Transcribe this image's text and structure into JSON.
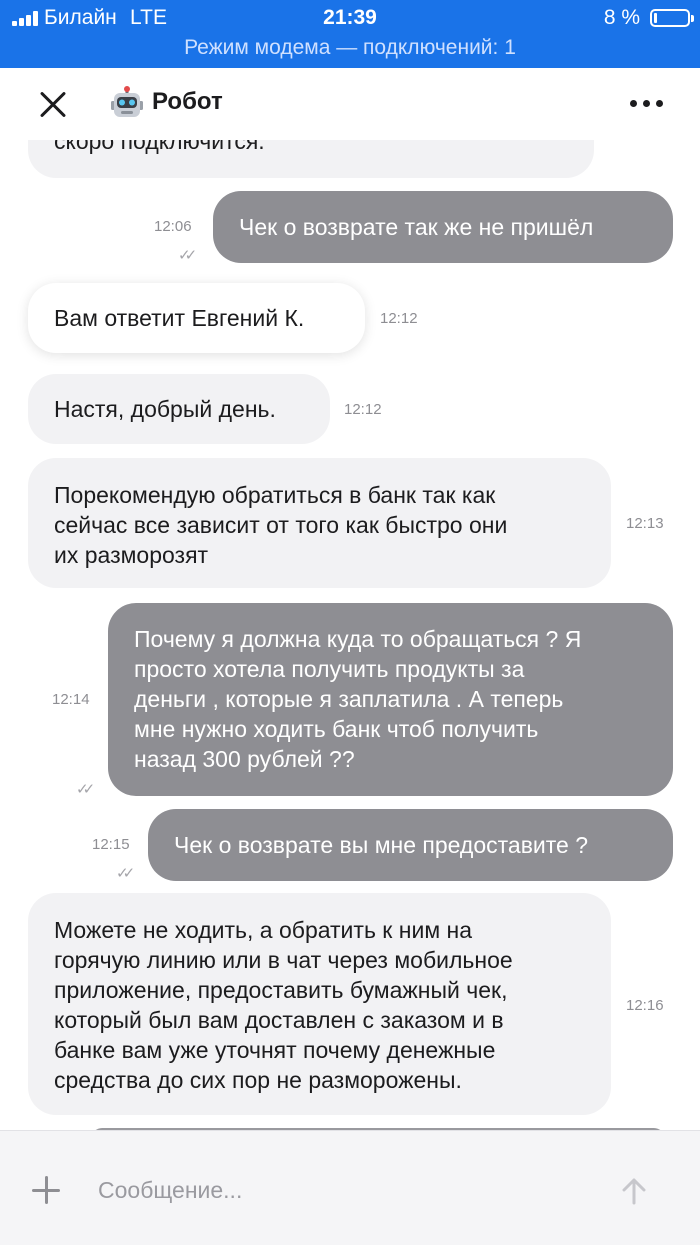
{
  "status_bar": {
    "carrier": "Билайн",
    "network": "LTE",
    "time": "21:39",
    "battery": "8 %",
    "battery_level": 0.08,
    "hotspot": "Режим модема — подключений: 1",
    "color": "#1a73e8"
  },
  "header": {
    "title": "Робот",
    "avatar_icon": "robot-icon",
    "close_icon": "close-icon",
    "more_icon": "more-icon"
  },
  "messages": [
    {
      "direction": "in",
      "text": "скоро подключится.",
      "time": ""
    },
    {
      "direction": "out",
      "text": "Чек о возврате так же не пришёл",
      "time": "12:06",
      "read": true
    },
    {
      "direction": "in",
      "text": "Вам ответит Евгений К.",
      "time": "12:12"
    },
    {
      "direction": "in",
      "text": "Настя, добрый день.",
      "time": "12:12"
    },
    {
      "direction": "in",
      "text": "Порекомендую обратиться в банк так как\nсейчас все зависит от того как быстро они\nих разморозят",
      "time": "12:13"
    },
    {
      "direction": "out",
      "text": "Почему я должна куда то обращаться ? Я\nпросто хотела получить продукты за\nденьги , которые я заплатила . А теперь\nмне нужно ходить банк чтоб получить\nназад 300 рублей ??",
      "time": "12:14",
      "read": true
    },
    {
      "direction": "out",
      "text": "Чек о возврате вы мне предоставите ?",
      "time": "12:15",
      "read": true
    },
    {
      "direction": "in",
      "text": "Можете не ходить, а обратить к ним на\nгорячую линию или в чат через мобильное\nприложение, предоставить бумажный чек,\nкоторый был вам доставлен с заказом и в\nбанке вам уже уточнят почему денежные\nсредства до сих пор не разморожены.",
      "time": "12:16"
    }
  ],
  "composer": {
    "placeholder": "Сообщение...",
    "value": ""
  },
  "colors": {
    "incoming_bubble": "#f2f2f4",
    "outgoing_bubble": "#8e8e93",
    "timestamp": "#8e8e93"
  }
}
